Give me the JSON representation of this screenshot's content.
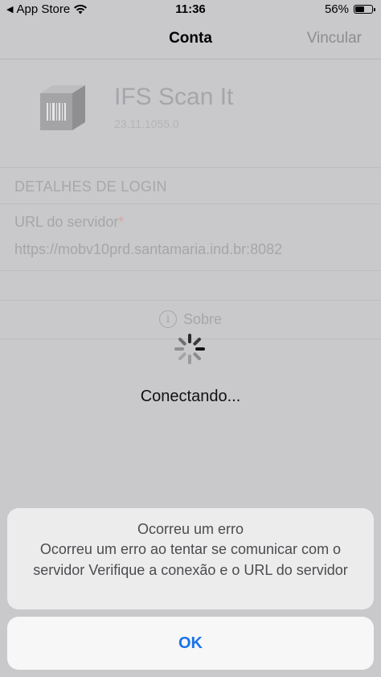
{
  "status_bar": {
    "back_app": "App Store",
    "time": "11:36",
    "battery": "56%",
    "battery_level": 0.56
  },
  "nav": {
    "title": "Conta",
    "action": "Vincular"
  },
  "app": {
    "name": "IFS Scan It",
    "version": "23.11.1055.0"
  },
  "login": {
    "section_title": "DETALHES DE LOGIN",
    "server_label": "URL do servidor",
    "required_mark": "*",
    "server_value": "https://mobv10prd.santamaria.ind.br:8082"
  },
  "about": {
    "label": "Sobre",
    "icon": "info-icon"
  },
  "loading": {
    "text": "Conectando..."
  },
  "alert": {
    "title": "Ocorreu um erro",
    "message": "Ocorreu um erro ao tentar se comunicar com o servidor Verifique a conexão e o URL do servidor",
    "ok_label": "OK"
  },
  "colors": {
    "accent": "#1a73e8",
    "overlay": "#c9c9cc"
  }
}
